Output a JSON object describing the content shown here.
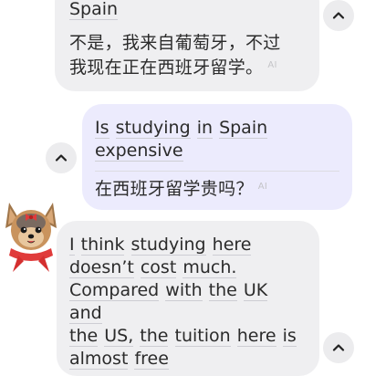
{
  "messages": [
    {
      "id": "m1",
      "speaker": "tutor",
      "english_words": [
        "Spain"
      ],
      "translation_lines": [
        "不是，我来自葡萄牙，不过",
        "我现在正在西班牙留学。"
      ],
      "ai_badge": "AI"
    },
    {
      "id": "m2",
      "speaker": "user",
      "english_lines": [
        [
          "Is",
          "studying",
          "in",
          "Spain"
        ],
        [
          "expensive"
        ]
      ],
      "translation": "在西班牙留学贵吗？",
      "ai_badge": "AI"
    },
    {
      "id": "m3",
      "speaker": "tutor",
      "english_lines": [
        [
          "I",
          "think",
          "studying",
          "here"
        ],
        [
          "doesn’t",
          "cost",
          "much."
        ],
        [
          "Compared",
          "with",
          "the",
          "UK",
          "and"
        ],
        [
          "the",
          "US,",
          "the",
          "tuition",
          "here",
          "is"
        ],
        [
          "almost",
          "free"
        ]
      ]
    }
  ],
  "colors": {
    "tutor_bubble": "#efeff1",
    "user_bubble": "#ecebfd",
    "text": "#2b2b2b",
    "underline": "#cdcdd3"
  },
  "icons": [
    "chevron-up-icon",
    "avatar-yorkie-dog"
  ]
}
